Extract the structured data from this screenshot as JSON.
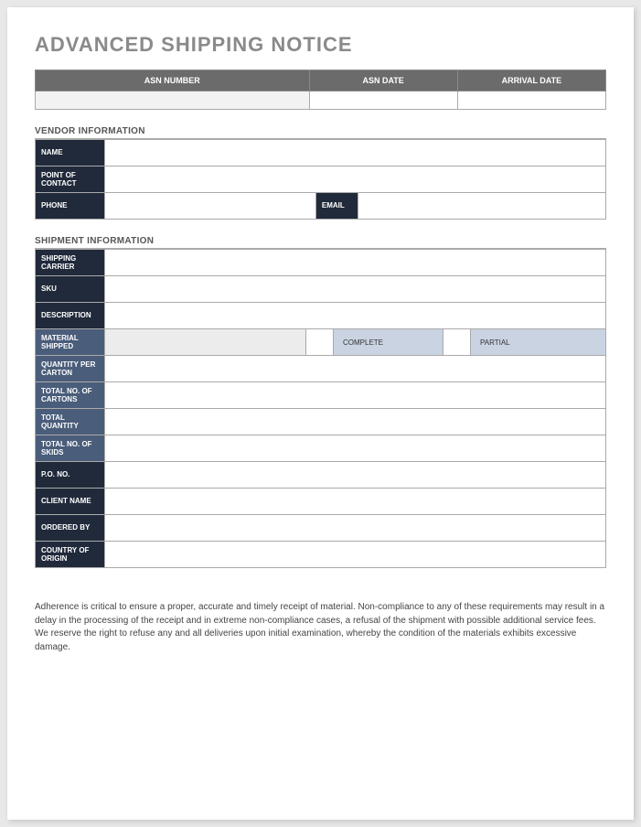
{
  "title": "ADVANCED SHIPPING NOTICE",
  "asn_header": {
    "col1": "ASN NUMBER",
    "col2": "ASN DATE",
    "col3": "ARRIVAL DATE"
  },
  "vendor_section": {
    "heading": "VENDOR INFORMATION",
    "name_label": "NAME",
    "poc_label": "POINT OF CONTACT",
    "phone_label": "PHONE",
    "email_label": "EMAIL"
  },
  "shipment_section": {
    "heading": "SHIPMENT INFORMATION",
    "carrier_label": "SHIPPING CARRIER",
    "sku_label": "SKU",
    "description_label": "DESCRIPTION",
    "material_label": "MATERIAL SHIPPED",
    "complete_label": "COMPLETE",
    "partial_label": "PARTIAL",
    "qty_carton_label": "QUANTITY PER CARTON",
    "total_cartons_label": "TOTAL NO. OF CARTONS",
    "total_qty_label": "TOTAL QUANTITY",
    "total_skids_label": "TOTAL NO. OF SKIDS",
    "po_label": "P.O. NO.",
    "client_label": "CLIENT NAME",
    "ordered_by_label": "ORDERED BY",
    "country_label": "COUNTRY OF ORIGIN"
  },
  "footer": "Adherence is critical to ensure a proper, accurate and timely receipt of material. Non-compliance to any of these requirements may result in a delay in the processing of the receipt and in extreme non-compliance cases, a refusal of the shipment with possible additional service fees. We reserve the right to refuse any and all deliveries upon initial examination, whereby the condition of the materials exhibits excessive damage."
}
